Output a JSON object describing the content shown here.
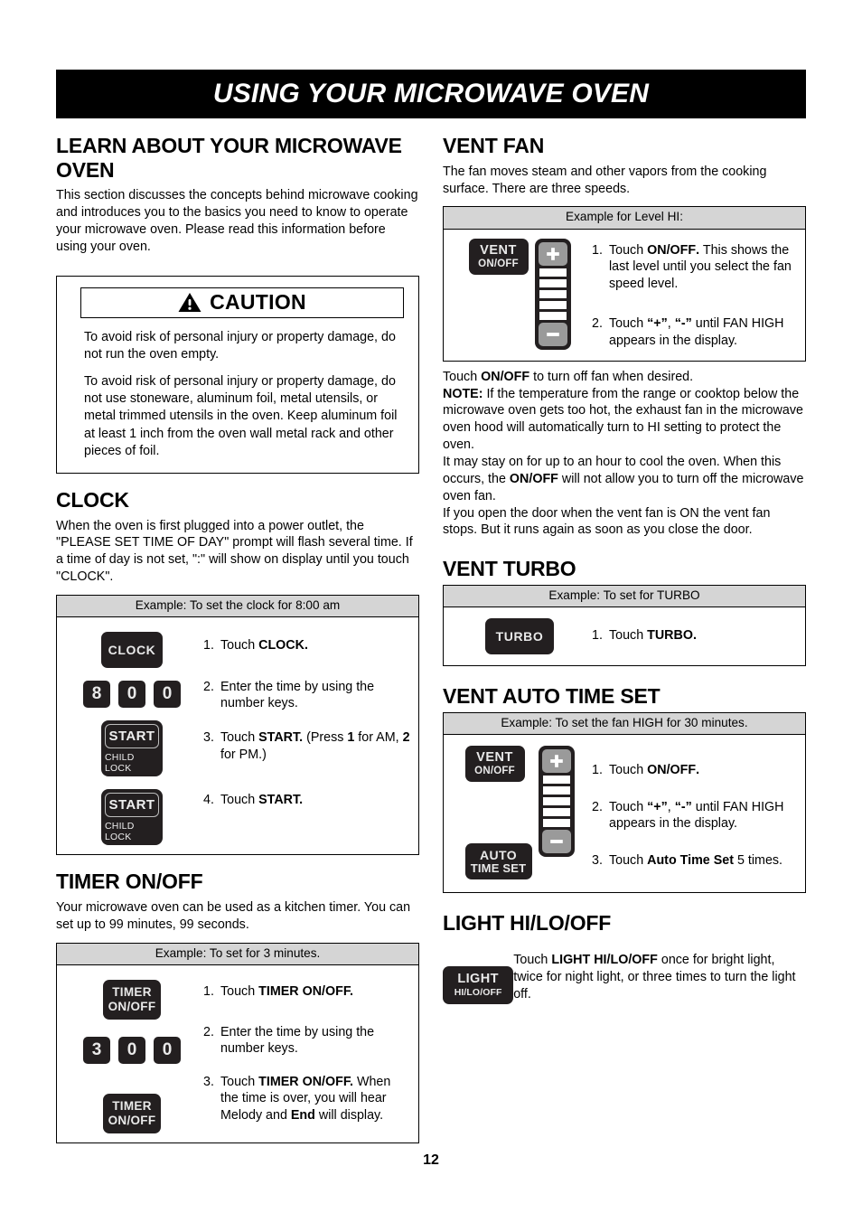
{
  "page": {
    "banner_title": "USING YOUR MICROWAVE OVEN",
    "page_number": "12"
  },
  "left_column": {
    "learn": {
      "title": "LEARN ABOUT YOUR MICROWAVE OVEN",
      "intro": "This section discusses the concepts behind microwave cooking and introduces you to the basics you need to know to operate your microwave oven. Please read this information before using your oven."
    },
    "caution": {
      "label": "CAUTION",
      "icon": "warning-triangle-icon",
      "paragraph_1": "To avoid risk of personal injury or property damage, do not run the oven empty.",
      "paragraph_2": "To avoid risk of personal injury or property damage, do not use stoneware, aluminum foil, metal utensils, or metal trimmed utensils in the oven. Keep aluminum foil at least 1 inch from the oven wall metal rack and other pieces of foil."
    },
    "clock": {
      "title": "CLOCK",
      "intro": "When the oven is first plugged into a power outlet, the \"PLEASE SET TIME OF DAY\" prompt will flash several time. If a time of day is not set, \":\" will show on display until you touch \"CLOCK\".",
      "example_head": "Example: To set the clock for 8:00 am",
      "buttons": {
        "clock": "CLOCK",
        "start": "START",
        "child_lock": "CHILD LOCK"
      },
      "numbers": [
        "8",
        "0",
        "0"
      ],
      "steps": [
        {
          "num": "1.",
          "text": "Touch CLOCK."
        },
        {
          "num": "2.",
          "text": "Enter the time by using the number keys."
        },
        {
          "num": "3.",
          "text": "Touch START. (Press 1 for AM, 2 for PM.)"
        },
        {
          "num": "4.",
          "text": "Touch START."
        }
      ]
    },
    "timer": {
      "title": "TIMER ON/OFF",
      "intro": "Your microwave oven can be used as a kitchen timer. You can set up to 99 minutes, 99 seconds.",
      "example_head": "Example: To set for 3 minutes.",
      "button": {
        "line1": "TIMER",
        "line2": "ON/OFF"
      },
      "numbers": [
        "3",
        "0",
        "0"
      ],
      "steps": [
        {
          "num": "1.",
          "text": "Touch  TIMER ON/OFF."
        },
        {
          "num": "2.",
          "text": "Enter the time by using the number keys."
        },
        {
          "num": "3.",
          "text": "Touch TIMER ON/OFF. When the time is over, you will hear Melody and End will display."
        }
      ]
    }
  },
  "right_column": {
    "vent_fan": {
      "title": "VENT FAN",
      "intro": "The fan moves steam and other vapors from the cooking surface. There are three speeds.",
      "example_head": "Example for Level HI:",
      "button": {
        "line1": "VENT",
        "line2": "ON/OFF"
      },
      "slider": {
        "plus": "+",
        "minus": "–",
        "bars": 5
      },
      "steps": [
        {
          "num": "1.",
          "text": "Touch ON/OFF. This shows the last level until you select the fan speed level."
        },
        {
          "num": "2.",
          "text": "Touch “+”, “-” until FAN HIGH appears in the display."
        }
      ],
      "notes": [
        "Touch ON/OFF to turn off fan when desired.",
        "NOTE: If the temperature from the range or cooktop below the microwave oven gets too hot, the exhaust fan in the microwave oven hood will automatically turn to HI setting to protect the oven.",
        "It may stay on for up to an hour to cool the oven.  When this occurs, the ON/OFF will not allow you to turn off the microwave oven fan.",
        "If you open the door when the vent fan is ON the vent fan stops. But it runs again as soon as you close the door."
      ]
    },
    "vent_turbo": {
      "title": "VENT TURBO",
      "example_head": "Example: To set for TURBO",
      "button": "TURBO",
      "steps": [
        {
          "num": "1.",
          "text": "Touch TURBO."
        }
      ]
    },
    "vent_auto_time_set": {
      "title": "VENT AUTO TIME SET",
      "example_head": "Example: To set the fan HIGH for 30 minutes.",
      "button_vent": {
        "line1": "VENT",
        "line2": "ON/OFF"
      },
      "button_auto": {
        "line1": "AUTO",
        "line2": "TIME SET"
      },
      "slider": {
        "plus": "+",
        "minus": "–",
        "bars": 5
      },
      "steps": [
        {
          "num": "1.",
          "text": "Touch ON/OFF."
        },
        {
          "num": "2.",
          "text": "Touch “+”, “-” until FAN HIGH appears in the display."
        },
        {
          "num": "3.",
          "text": "Touch Auto Time Set 5 times."
        }
      ]
    },
    "light": {
      "title": "LIGHT HI/LO/OFF",
      "button": {
        "line1": "LIGHT",
        "line2": "HI/LO/OFF"
      },
      "text": "Touch LIGHT HI/LO/OFF once for bright light, twice for night light, or three times to turn the light off."
    }
  },
  "colors": {
    "banner_bg": "#000000",
    "banner_text": "#ffffff",
    "button_bg": "#231f20",
    "button_text": "#e9e9e9",
    "example_header_bg": "#d5d5d5",
    "slider_pm_bg": "#9a9a9a"
  }
}
